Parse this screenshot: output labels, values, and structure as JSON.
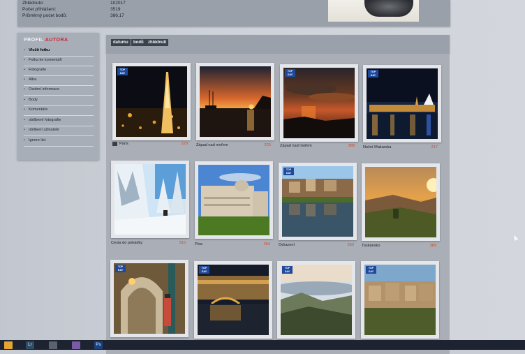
{
  "stats": {
    "rows": [
      {
        "label": "Zhlédnuto:",
        "value": "102017"
      },
      {
        "label": "Počet přihlášení:",
        "value": "3519"
      },
      {
        "label": "Průměrný počet bodů:",
        "value": "386,17"
      }
    ]
  },
  "sidebar": {
    "title_part1": "PROFIL ",
    "title_part2": "AUTORA",
    "accent_color": "#d8202e",
    "items": [
      {
        "label": "Vložit fotku"
      },
      {
        "label": "Fotka ke komentáři"
      },
      {
        "label": "Fotografie"
      },
      {
        "label": "Alba"
      },
      {
        "label": "Osobní informace"
      },
      {
        "label": "Body"
      },
      {
        "label": "Komentáře"
      },
      {
        "label": "oblíbené fotografie"
      },
      {
        "label": "oblíbení uživatelé"
      },
      {
        "label": "Ignore list"
      }
    ]
  },
  "sortbar": {
    "buttons": [
      {
        "label": "datumu"
      },
      {
        "label": "bodů"
      },
      {
        "label": "zhlédnutí"
      }
    ]
  },
  "badge": {
    "line1": "TOP",
    "line2": "DAY",
    "color": "#1f4a9c"
  },
  "gallery": {
    "rows": [
      [
        {
          "caption": "Paris",
          "count": "220",
          "top_day": true,
          "flag": true
        },
        {
          "caption": "Západ nad mořem",
          "count": "225",
          "top_day": false,
          "flag": false
        },
        {
          "caption": "Západ nad mořem",
          "count": "388",
          "top_day": true,
          "flag": false
        },
        {
          "caption": "Noční Makarska",
          "count": "217",
          "top_day": true,
          "flag": false
        }
      ],
      [
        {
          "caption": "Cesta do pohádky",
          "count": "315",
          "top_day": false,
          "flag": false
        },
        {
          "caption": "Pisa",
          "count": "264",
          "top_day": false,
          "flag": false
        },
        {
          "caption": "Odrazení",
          "count": "553",
          "top_day": true,
          "flag": false
        },
        {
          "caption": "Toskánsko",
          "count": "389",
          "top_day": false,
          "flag": false
        }
      ],
      [
        {
          "caption": "",
          "count": "",
          "top_day": true,
          "flag": false
        },
        {
          "caption": "",
          "count": "",
          "top_day": true,
          "flag": false
        },
        {
          "caption": "",
          "count": "",
          "top_day": true,
          "flag": false
        },
        {
          "caption": "",
          "count": "",
          "top_day": true,
          "flag": false
        }
      ]
    ]
  },
  "taskbar": {
    "apps": [
      {
        "icon": "explorer-icon",
        "label": "",
        "color": "#e5a534"
      },
      {
        "icon": "lightroom-icon",
        "label": "Lr",
        "color": "#2f4c66"
      },
      {
        "icon": "calculator-icon",
        "label": "",
        "color": "#5a6270"
      },
      {
        "icon": "photos-icon",
        "label": "",
        "color": "#7a5ba6"
      },
      {
        "icon": "photoshop-icon",
        "label": "Ps",
        "color": "#1f3f7a"
      }
    ]
  }
}
